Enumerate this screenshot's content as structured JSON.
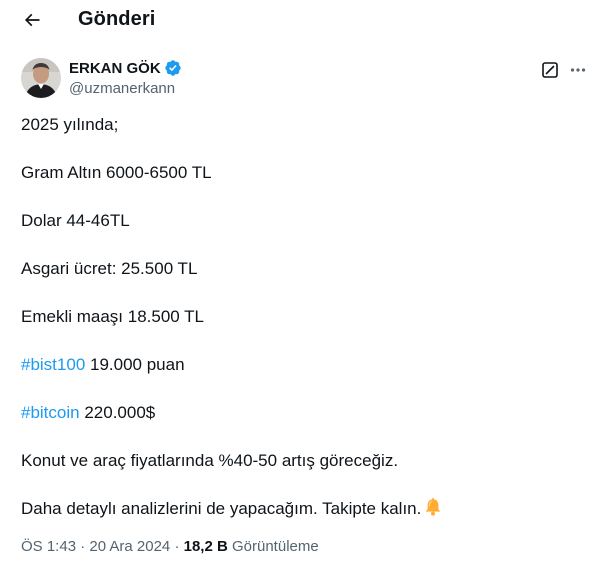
{
  "header": {
    "title": "Gönderi",
    "back_icon": "arrow-left-icon"
  },
  "author": {
    "name": "ERKAN GÖK",
    "handle": "@uzmanerkann",
    "verified": true,
    "verified_color": "#1d9bf0"
  },
  "actions": {
    "grok_icon": "grok-icon",
    "more_icon": "more-horizontal-icon"
  },
  "tweet": {
    "line1": "2025 yılında;",
    "line2": "Gram Altın 6000-6500 TL",
    "line3": "Dolar 44-46TL",
    "line4": "Asgari ücret: 25.500 TL",
    "line5": "Emekli maaşı 18.500 TL",
    "hashtag1": "#bist100",
    "line6_rest": " 19.000 puan",
    "hashtag2": "#bitcoin",
    "line7_rest": " 220.000$",
    "line8": "Konut ve araç fiyatlarında %40-50 artış göreceğiz.",
    "line9": "Daha detaylı analizlerini de yapacağım. Takipte kalın.",
    "bell_icon": "bell-emoji-icon"
  },
  "meta": {
    "time": "ÖS 1:43 · 20 Ara 2024",
    "separator": " · ",
    "views_count": "18,2 B",
    "views_label": " Görüntüleme"
  },
  "colors": {
    "text": "#0f1419",
    "secondary": "#536471",
    "link": "#1d9bf0"
  }
}
